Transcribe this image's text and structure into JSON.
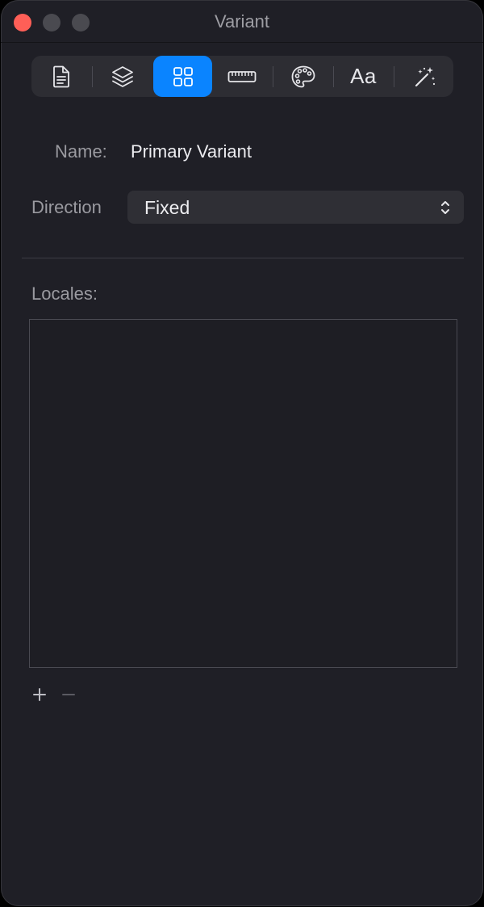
{
  "window": {
    "title": "Variant"
  },
  "toolbar": {
    "items": [
      {
        "name": "document",
        "icon": "document-icon"
      },
      {
        "name": "layers",
        "icon": "layers-stack-icon"
      },
      {
        "name": "grid",
        "icon": "grid-icon",
        "active": true
      },
      {
        "name": "ruler",
        "icon": "ruler-icon"
      },
      {
        "name": "palette",
        "icon": "palette-icon"
      },
      {
        "name": "typography",
        "label": "Aa"
      },
      {
        "name": "effects",
        "icon": "magic-wand-icon"
      }
    ]
  },
  "form": {
    "name_label": "Name:",
    "name_value": "Primary Variant",
    "direction_label": "Direction",
    "direction_value": "Fixed"
  },
  "locales": {
    "label": "Locales:",
    "items": [],
    "add_label": "+",
    "remove_label": "−"
  },
  "colors": {
    "accent": "#0a84ff",
    "window_bg": "#1f1f26",
    "close": "#ff5f57"
  }
}
